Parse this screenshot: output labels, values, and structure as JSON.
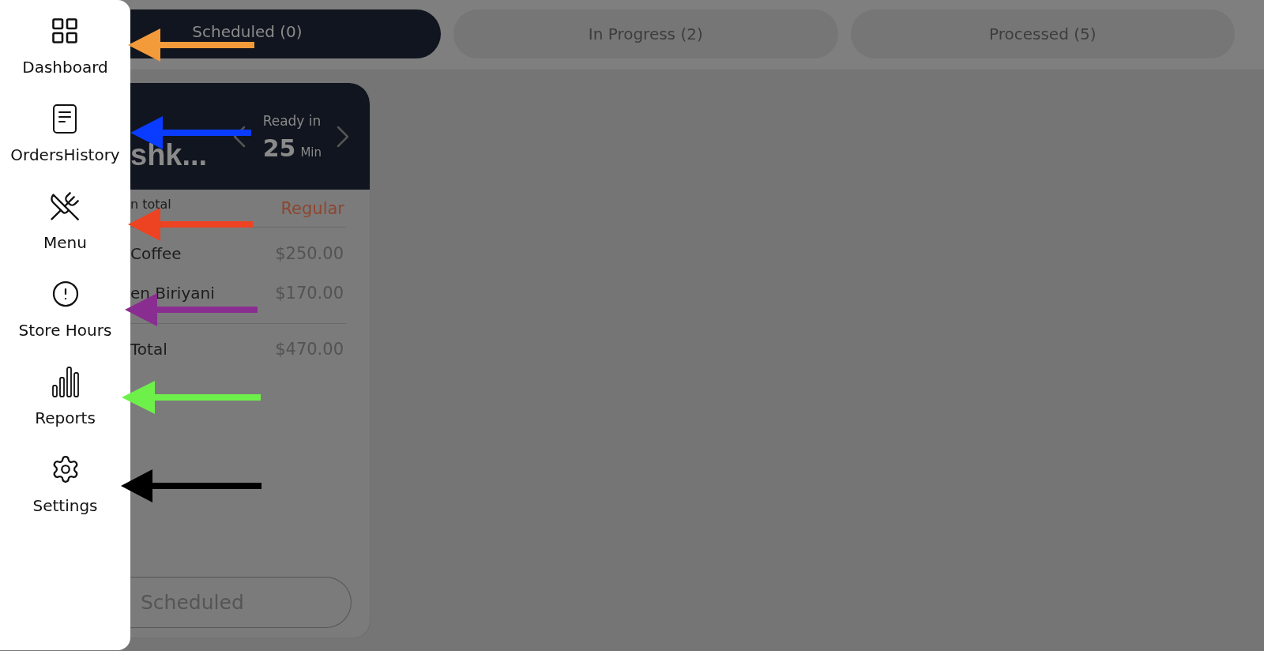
{
  "sidebar": {
    "items": [
      {
        "label": "Dashboard"
      },
      {
        "label": "OrdersHistory"
      },
      {
        "label": "Menu"
      },
      {
        "label": "Store Hours"
      },
      {
        "label": "Reports"
      },
      {
        "label": "Settings"
      }
    ]
  },
  "tabs": [
    {
      "label": "Scheduled (0)",
      "selected": true
    },
    {
      "label": "In Progress (2)",
      "selected": false
    },
    {
      "label": "Processed (5)",
      "selected": false
    }
  ],
  "order_card": {
    "name": "shk...",
    "ready_label": "Ready in",
    "ready_value": "25",
    "ready_unit": "Min",
    "column_label": "n total",
    "order_type": "Regular",
    "items": [
      {
        "name": "Coffee",
        "price": "$250.00"
      },
      {
        "name": "en Biriyani",
        "price": "$170.00"
      }
    ],
    "total_label": "Total",
    "total_value": "$470.00",
    "status_button": "Scheduled"
  },
  "annotation_arrows": [
    {
      "color": "#f39a3a"
    },
    {
      "color": "#0a3cff"
    },
    {
      "color": "#ee4322"
    },
    {
      "color": "#8a2d90"
    },
    {
      "color": "#6ef04a"
    },
    {
      "color": "#000000"
    }
  ]
}
